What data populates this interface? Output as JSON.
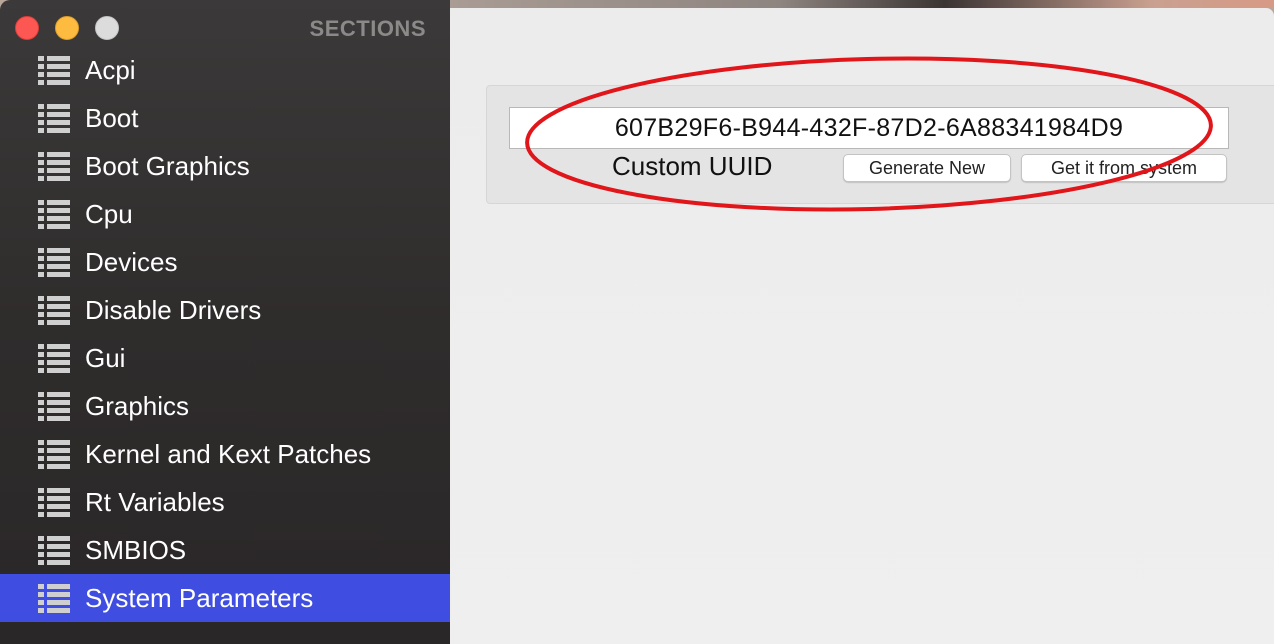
{
  "window": {
    "sidebar_header": "SECTIONS"
  },
  "sidebar": {
    "items": [
      {
        "label": "Acpi",
        "icon": "list-icon",
        "selected": false
      },
      {
        "label": "Boot",
        "icon": "list-icon",
        "selected": false
      },
      {
        "label": "Boot Graphics",
        "icon": "list-icon",
        "selected": false
      },
      {
        "label": "Cpu",
        "icon": "list-icon",
        "selected": false
      },
      {
        "label": "Devices",
        "icon": "list-icon",
        "selected": false
      },
      {
        "label": "Disable Drivers",
        "icon": "list-icon",
        "selected": false
      },
      {
        "label": "Gui",
        "icon": "list-icon",
        "selected": false
      },
      {
        "label": "Graphics",
        "icon": "list-icon",
        "selected": false
      },
      {
        "label": "Kernel and Kext Patches",
        "icon": "list-icon",
        "selected": false
      },
      {
        "label": "Rt Variables",
        "icon": "list-icon",
        "selected": false
      },
      {
        "label": "SMBIOS",
        "icon": "list-icon",
        "selected": false
      },
      {
        "label": "System Parameters",
        "icon": "list-icon",
        "selected": true
      }
    ]
  },
  "main": {
    "uuid_value": "607B29F6-B944-432F-87D2-6A88341984D9",
    "uuid_label": "Custom UUID",
    "generate_button": "Generate New",
    "system_button": "Get it from system"
  },
  "colors": {
    "selection": "#3f4ee0",
    "annotation": "#e0161b",
    "close": "#fc5753",
    "minimize": "#fdbc40"
  }
}
